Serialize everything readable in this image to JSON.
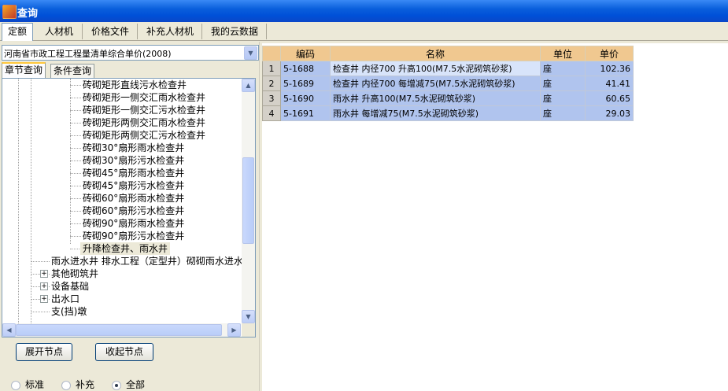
{
  "window": {
    "title": "查询"
  },
  "tabs": [
    {
      "label": "定额",
      "active": true
    },
    {
      "label": "人材机",
      "active": false
    },
    {
      "label": "价格文件",
      "active": false
    },
    {
      "label": "补充人材机",
      "active": false
    },
    {
      "label": "我的云数据",
      "active": false
    }
  ],
  "left": {
    "library_select": "河南省市政工程工程量清单综合单价(2008)",
    "subtabs": [
      {
        "label": "章节查询",
        "active": true
      },
      {
        "label": "条件查询",
        "active": false
      }
    ],
    "tree_items": [
      "砖砌矩形直线污水检查井",
      "砖砌矩形一侧交汇雨水检查井",
      "砖砌矩形一侧交汇污水检查井",
      "砖砌矩形两侧交汇雨水检查井",
      "砖砌矩形两侧交汇污水检查井",
      "砖砌30°扇形雨水检查井",
      "砖砌30°扇形污水检查井",
      "砖砌45°扇形雨水检查井",
      "砖砌45°扇形污水检查井",
      "砖砌60°扇形雨水检查井",
      "砖砌60°扇形污水检查井",
      "砖砌90°扇形雨水检查井",
      "砖砌90°扇形污水检查井",
      "升降检查井、雨水井"
    ],
    "tree_parent_items": [
      {
        "label": "雨水进水井 排水工程（定型井）砌砌雨水进水",
        "expander": false
      },
      {
        "label": "其他砌筑井",
        "expander": true
      },
      {
        "label": "设备基础",
        "expander": true
      },
      {
        "label": "出水口",
        "expander": true
      },
      {
        "label": "支(挡)墩",
        "expander": false
      }
    ],
    "expand_button": "展开节点",
    "collapse_button": "收起节点",
    "radios": [
      {
        "label": "标准",
        "checked": false
      },
      {
        "label": "补充",
        "checked": false
      },
      {
        "label": "全部",
        "checked": true
      }
    ]
  },
  "grid": {
    "headers": {
      "code": "编码",
      "name": "名称",
      "unit": "单位",
      "price": "单价"
    },
    "rows": [
      {
        "n": "1",
        "code": "5-1688",
        "name": "检查井 内径700 升高100(M7.5水泥砌筑砂浆)",
        "unit": "座",
        "price": "102.36"
      },
      {
        "n": "2",
        "code": "5-1689",
        "name": "检查井 内径700 每增减75(M7.5水泥砌筑砂浆)",
        "unit": "座",
        "price": "41.41"
      },
      {
        "n": "3",
        "code": "5-1690",
        "name": "雨水井 升高100(M7.5水泥砌筑砂浆)",
        "unit": "座",
        "price": "60.65"
      },
      {
        "n": "4",
        "code": "5-1691",
        "name": "雨水井 每增减75(M7.5水泥砌筑砂浆)",
        "unit": "座",
        "price": "29.03"
      }
    ]
  }
}
